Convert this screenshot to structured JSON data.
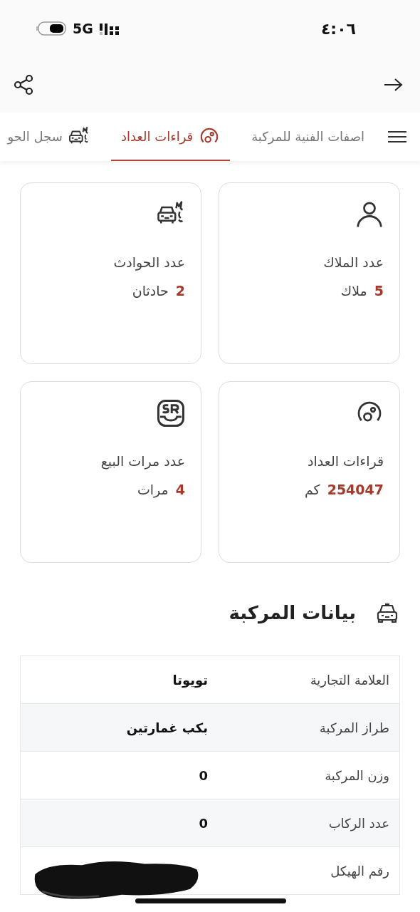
{
  "status_bar": {
    "time": "٤:٠٦",
    "network": "5G"
  },
  "tabs": [
    {
      "label": "اصفات الفنية للمركبة",
      "kind": "plain",
      "selected": false
    },
    {
      "label": "قراءات العداد",
      "kind": "odometer",
      "selected": true
    },
    {
      "label": "سجل الحو",
      "kind": "accidents",
      "selected": false
    }
  ],
  "cards": [
    {
      "kind": "owners",
      "label": "عدد الملاك",
      "value": "5",
      "unit": "ملاك"
    },
    {
      "kind": "accidents",
      "label": "عدد الحوادث",
      "value": "2",
      "unit": "حادثان"
    },
    {
      "kind": "odometer",
      "label": "قراءات العداد",
      "value": "254047",
      "unit": "كم"
    },
    {
      "kind": "sales",
      "label": "عدد مرات البيع",
      "value": "4",
      "unit": "مرات"
    }
  ],
  "vehicle_section": {
    "title": "بيانات المركبة",
    "rows": [
      {
        "label": "العلامة التجارية",
        "value": "تويوتا"
      },
      {
        "label": "طراز المركبة",
        "value": "بكب غمارتين"
      },
      {
        "label": "وزن المركبة",
        "value": "0"
      },
      {
        "label": "عدد الركاب",
        "value": "0"
      },
      {
        "label": "رقم الهيكل",
        "redacted": true
      }
    ]
  }
}
